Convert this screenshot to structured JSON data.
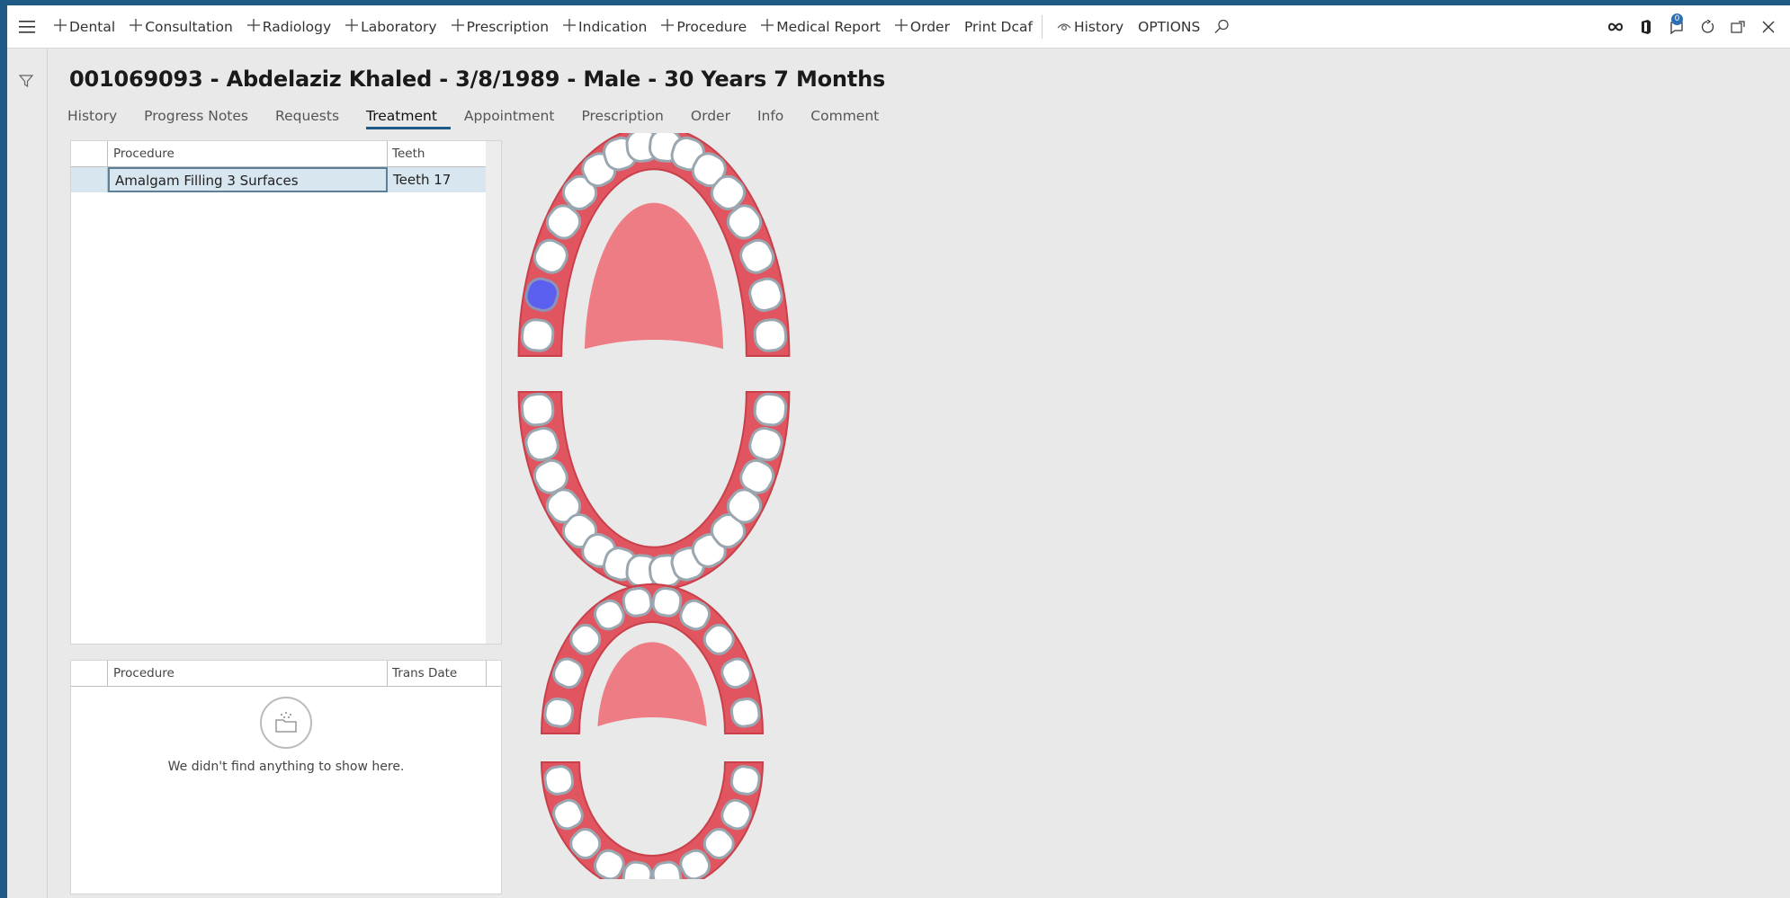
{
  "actionbar": {
    "items": [
      {
        "label": "Dental",
        "plus": true
      },
      {
        "label": "Consultation",
        "plus": true
      },
      {
        "label": "Radiology",
        "plus": true
      },
      {
        "label": "Laboratory",
        "plus": true
      },
      {
        "label": "Prescription",
        "plus": true
      },
      {
        "label": "Indication",
        "plus": true
      },
      {
        "label": "Procedure",
        "plus": true
      },
      {
        "label": "Medical Report",
        "plus": true
      },
      {
        "label": "Order",
        "plus": true
      },
      {
        "label": "Print Dcaf",
        "plus": false
      },
      {
        "label": "History",
        "plus": false
      },
      {
        "label": "OPTIONS",
        "plus": false
      }
    ],
    "notification_count": "0"
  },
  "patient": {
    "header": "001069093 - Abdelaziz Khaled - 3/8/1989 - Male - 30 Years 7 Months"
  },
  "tabs": [
    "History",
    "Progress Notes",
    "Requests",
    "Treatment",
    "Appointment",
    "Prescription",
    "Order",
    "Info",
    "Comment"
  ],
  "active_tab": "Treatment",
  "treatment_grid": {
    "columns": [
      "Procedure",
      "Teeth"
    ],
    "rows": [
      {
        "procedure": "Amalgam Filling 3 Surfaces",
        "teeth": "Teeth 17"
      }
    ]
  },
  "history_grid": {
    "columns": [
      "Procedure",
      "Trans Date"
    ],
    "empty_message": "We didn't find anything to show here."
  },
  "colors": {
    "accent": "#1f5a86",
    "gum": "#e0555f",
    "palate": "#ee7c85",
    "tooth": "#ffffff",
    "tooth_border": "#9aa7b0",
    "selected_tooth": "#5b5ff0"
  },
  "icons": {
    "menu": "hamburger-icon",
    "filter": "filter-icon",
    "search": "search-icon"
  }
}
